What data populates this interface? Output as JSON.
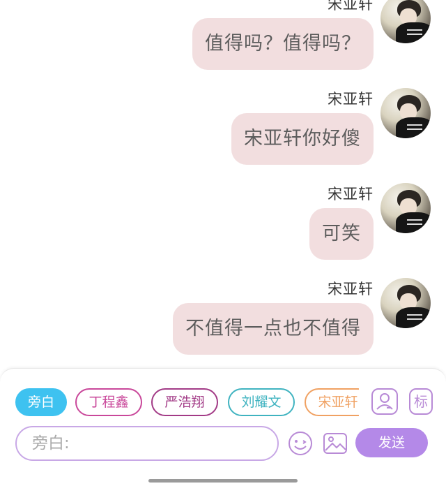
{
  "messages": [
    {
      "sender": "宋亚轩",
      "text": "值得吗？值得吗？"
    },
    {
      "sender": "宋亚轩",
      "text": "宋亚轩你好傻"
    },
    {
      "sender": "宋亚轩",
      "text": "可笑"
    },
    {
      "sender": "宋亚轩",
      "text": "不值得一点也不值得"
    }
  ],
  "roles": [
    {
      "label": "旁白",
      "color": "#3ec2f0",
      "selected": true
    },
    {
      "label": "丁程鑫",
      "color": "#c9479a"
    },
    {
      "label": "严浩翔",
      "color": "#a23a86"
    },
    {
      "label": "刘耀文",
      "color": "#3fb3c0"
    },
    {
      "label": "宋亚轩",
      "color": "#f0a162"
    }
  ],
  "toolbar": {
    "tag_label": "标",
    "input_placeholder": "旁白:",
    "send_label": "发送"
  },
  "colors": {
    "bubble": "#f2dedf",
    "accent": "#b489e8"
  }
}
